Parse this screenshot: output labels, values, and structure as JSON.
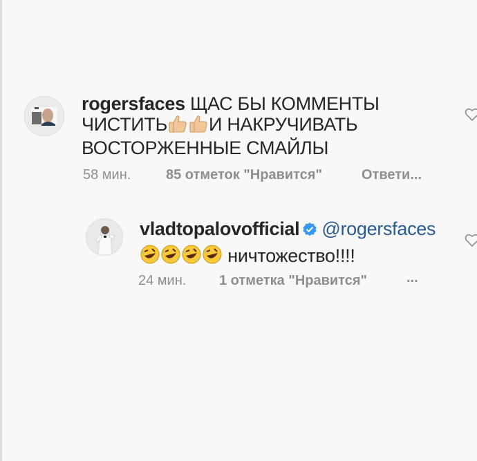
{
  "comment1": {
    "username": "rogersfaces",
    "text_line1": "ЩАС БЫ КОММЕНТЫ",
    "text_line2_before": "ЧИСТИТЬ",
    "text_line2_after": "И НАКРУЧИВАТЬ",
    "text_line3": "ВОСТОРЖЕННЫЕ СМАЙЛЫ",
    "time": "58 мин.",
    "likes": "85 отметок \"Нравится\"",
    "reply": "Ответи..."
  },
  "comment2": {
    "username": "vladtopalovofficial",
    "mention": "@rogersfaces",
    "text": "ничтожество!!!!",
    "time": "24 мин.",
    "likes": "1 отметка \"Нравится\"",
    "more": "..."
  },
  "colors": {
    "background": "#f8f8f8",
    "text": "#262626",
    "meta": "#8e8e8e",
    "verified": "#3897f0",
    "mention": "#2a5b8f"
  }
}
